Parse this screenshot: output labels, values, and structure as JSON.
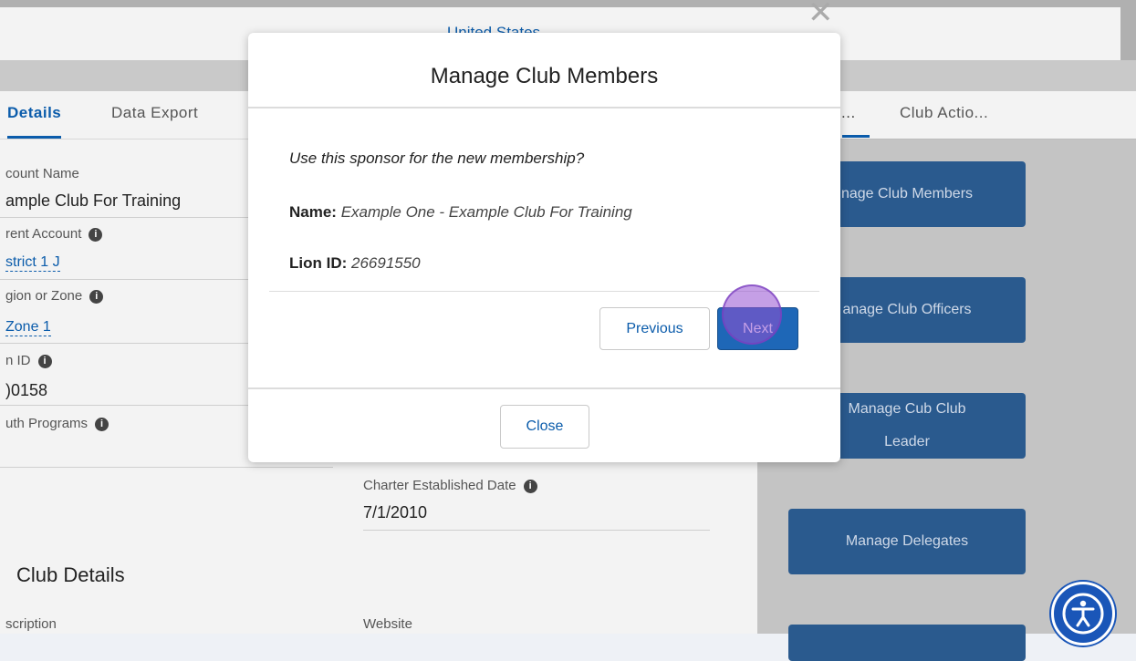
{
  "background": {
    "address_line": "United States",
    "tabs": {
      "details": "Details",
      "data_export": "Data Export"
    },
    "fields": {
      "account_name_label": "count Name",
      "account_name_value": "ample Club For Training",
      "parent_account_label": "rent Account",
      "parent_account_value": "strict 1 J",
      "region_zone_label": "gion or Zone",
      "region_zone_value": "Zone 1",
      "lion_id_label": "n ID",
      "lion_id_value": ")0158",
      "youth_programs_label": "uth Programs",
      "charter_date_label": "Charter Established Date",
      "charter_date_value": "7/1/2010",
      "club_details_title": "Club Details",
      "description_label": "scription",
      "website_label": "Website"
    },
    "side_panel": {
      "tab_truncated": "...",
      "tab_club_actions": "Club Actio...",
      "buttons": {
        "manage_members": "nage Club Members",
        "manage_officers": "anage Club Officers",
        "manage_cub_leader_line1": "Manage Cub Club",
        "manage_cub_leader_line2": "Leader",
        "manage_delegates": "Manage Delegates"
      }
    }
  },
  "modal": {
    "title": "Manage Club Members",
    "question": "Use this sponsor for the new membership?",
    "name_label": "Name:",
    "name_value": "Example One - Example Club For Training",
    "lion_id_label": "Lion ID:",
    "lion_id_value": "26691550",
    "previous_label": "Previous",
    "next_label": "Next",
    "close_label": "Close"
  },
  "colors": {
    "accent": "#0b5cab",
    "primary_button": "#1e67b7",
    "click_marker": "#9650d2",
    "accessibility_button": "#1a56b8"
  },
  "icons": {
    "info": "info-icon",
    "close": "close-icon",
    "accessibility": "accessibility-icon"
  }
}
